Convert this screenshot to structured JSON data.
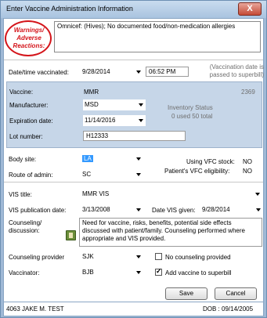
{
  "window": {
    "title": "Enter Vaccine Administration Information",
    "close_label": "X"
  },
  "warnings": {
    "label_line1": "Warnings/",
    "label_line2": "Adverse",
    "label_line3": "Reactions:",
    "text": "Omnicef:  (Hives); No documented food/non-medication allergies"
  },
  "administered": {
    "label": "Date/time vaccinated:",
    "date": "9/28/2014",
    "time": "06:52 PM",
    "note": "(Vaccination date is passed to superbill)"
  },
  "vaccine": {
    "vaccine_label": "Vaccine:",
    "vaccine_value": "MMR",
    "vaccine_code": "2369",
    "manufacturer_label": "Manufacturer:",
    "manufacturer_value": "MSD",
    "expiration_label": "Expiration date:",
    "expiration_value": "11/14/2016",
    "lot_label": "Lot number:",
    "lot_value": "H12333",
    "inventory_title": "Inventory Status",
    "inventory_text": "0 used 50 total"
  },
  "site": {
    "body_site_label": "Body site:",
    "body_site_value": "LA",
    "route_label": "Route of admin:",
    "route_value": "SC",
    "vfc_stock_label": "Using VFC stock:",
    "vfc_stock_value": "NO",
    "vfc_elig_label": "Patient's VFC eligibility:",
    "vfc_elig_value": "NO"
  },
  "vis": {
    "title_label": "VIS title:",
    "title_value": "MMR VIS",
    "pub_date_label": "VIS publication date:",
    "pub_date_value": "3/13/2008",
    "given_label": "Date VIS given:",
    "given_value": "9/28/2014"
  },
  "counseling": {
    "label_line1": "Counseling/",
    "label_line2": "discussion:",
    "text": "Need for vaccine, risks, benefits, potential side effects discussed with patient/family. Counseling performed where appropriate and VIS provided.",
    "provider_label": "Counseling provider",
    "provider_value": "SJK",
    "no_counseling_label": "No counseling provided",
    "no_counseling_checked": false
  },
  "vaccinator": {
    "label": "Vaccinator:",
    "value": "BJB",
    "superbill_label": "Add vaccine to superbill",
    "superbill_checked": true
  },
  "buttons": {
    "save_label": "Save",
    "cancel_label": "Cancel"
  },
  "footer": {
    "patient": "4063 JAKE M. TEST",
    "dob": "DOB : 09/14/2005"
  },
  "colors": {
    "warning_red": "#d4141a",
    "panel_blue": "#c6d6e8",
    "selection_blue": "#3399ff"
  }
}
